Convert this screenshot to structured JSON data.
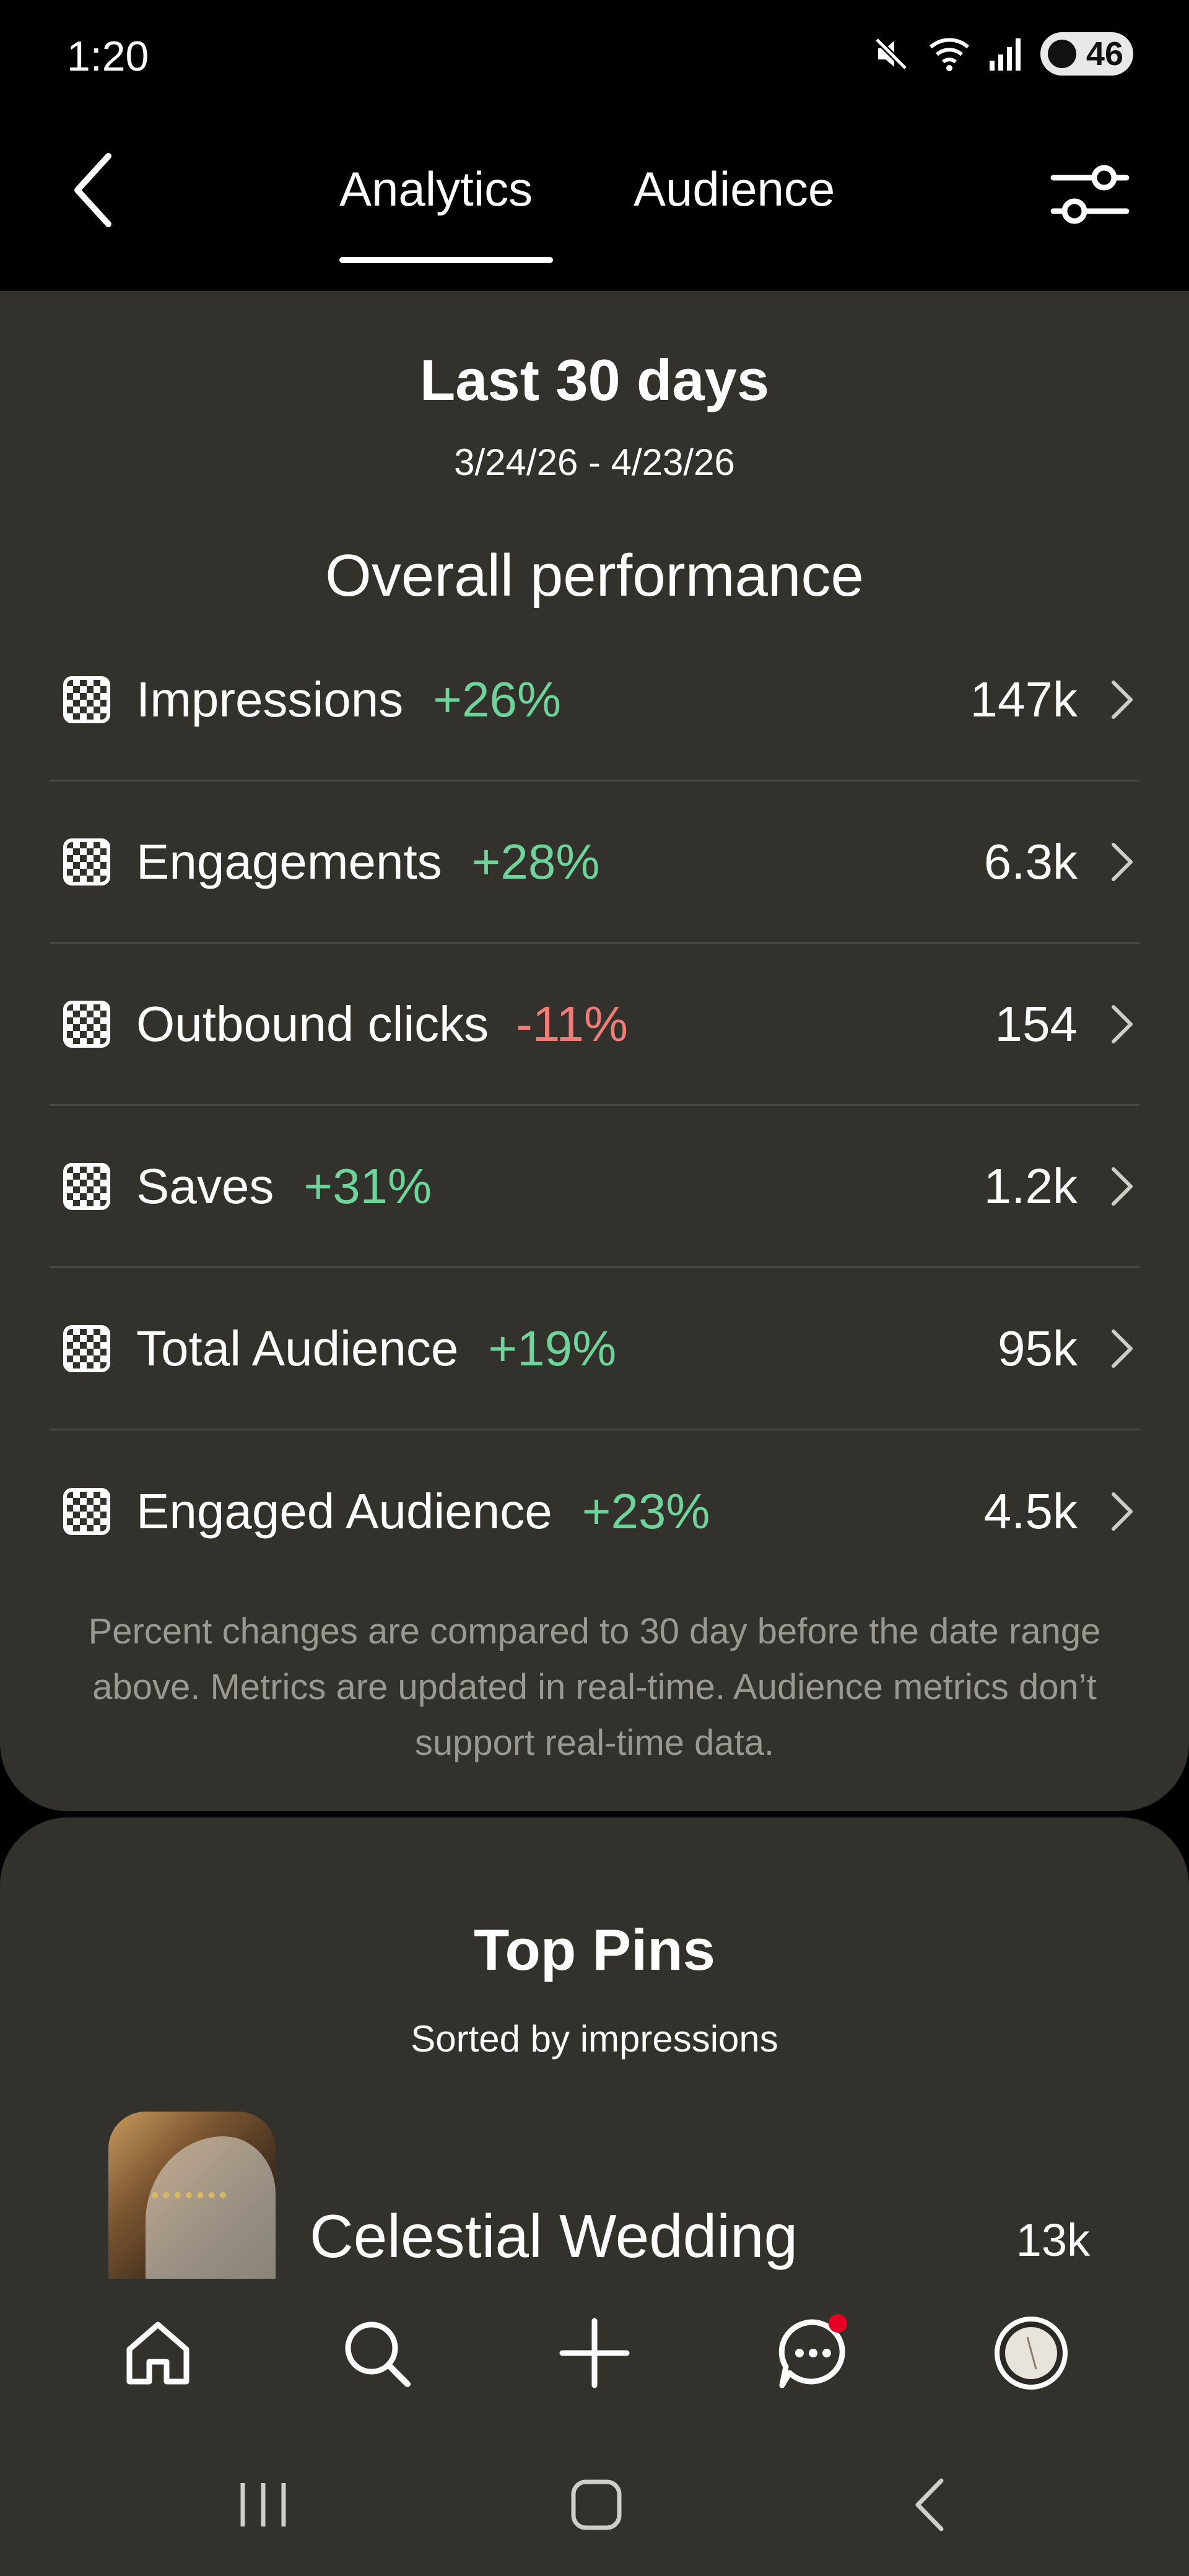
{
  "status_bar": {
    "time": "1:20",
    "battery": "46",
    "icons": [
      "mute-icon",
      "wifi-icon",
      "signal-icon",
      "battery-icon"
    ]
  },
  "header": {
    "tabs": [
      {
        "label": "Analytics",
        "selected": true
      },
      {
        "label": "Audience",
        "selected": false
      }
    ],
    "icons": [
      "back-icon",
      "filter-icon"
    ]
  },
  "performance": {
    "period_title": "Last 30 days",
    "date_range": "3/24/26 - 4/23/26",
    "section_title": "Overall performance",
    "metrics": [
      {
        "label": "Impressions",
        "change": "+26%",
        "trend": "up",
        "value": "147k"
      },
      {
        "label": "Engagements",
        "change": "+28%",
        "trend": "up",
        "value": "6.3k"
      },
      {
        "label": "Outbound clicks",
        "change": "-11%",
        "trend": "down",
        "value": "154"
      },
      {
        "label": "Saves",
        "change": "+31%",
        "trend": "up",
        "value": "1.2k"
      },
      {
        "label": "Total Audience",
        "change": "+19%",
        "trend": "up",
        "value": "95k"
      },
      {
        "label": "Engaged Audience",
        "change": "+23%",
        "trend": "up",
        "value": "4.5k"
      }
    ],
    "note": "Percent changes are compared to 30 day before the date range above. Metrics are updated in real-time. Audience metrics don’t support real-time data."
  },
  "top_pins": {
    "title": "Top Pins",
    "subtitle": "Sorted by impressions",
    "pins": [
      {
        "title": "Celestial Wedding",
        "value": "13k"
      }
    ]
  },
  "bottom_nav": {
    "items": [
      "home-icon",
      "search-icon",
      "plus-icon",
      "messages-icon",
      "profile-icon"
    ],
    "has_notification": true
  },
  "colors": {
    "background": "#000000",
    "card": "#32312c",
    "positive": "#6fd39c",
    "negative": "#f07c78",
    "muted": "#9a9891",
    "notification": "#e60023"
  }
}
